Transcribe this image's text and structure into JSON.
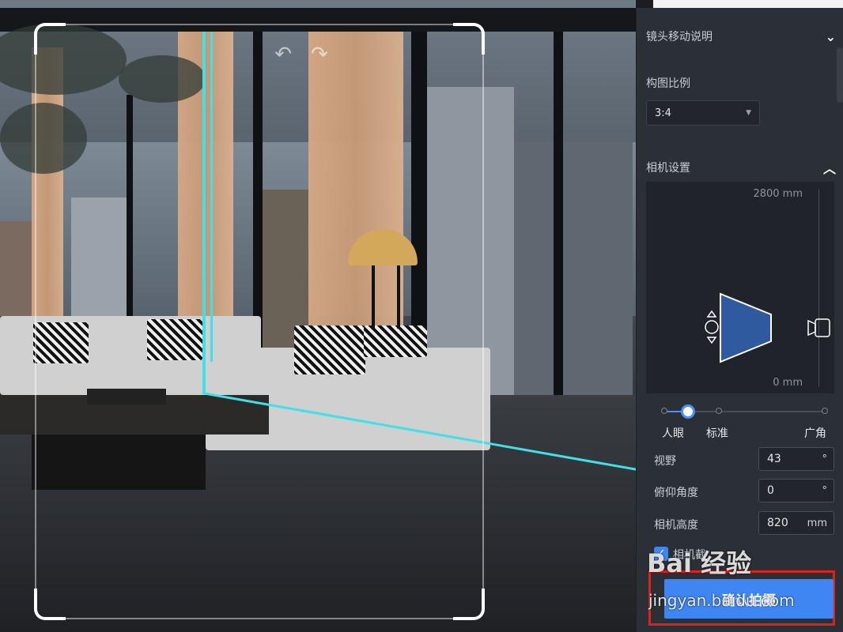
{
  "panel": {
    "lens_help_title": "镜头移动说明",
    "composition_title": "构图比例",
    "composition_value": "3:4",
    "camera_settings_title": "相机设置",
    "height_top_label": "2800 mm",
    "height_bottom_label": "0 mm",
    "lens_presets": [
      "人眼",
      "标准",
      "广角"
    ],
    "fov_label": "视野",
    "fov_value": "43",
    "fov_unit": "°",
    "tilt_label": "俯仰角度",
    "tilt_value": "0",
    "tilt_unit": "°",
    "height_label": "相机高度",
    "height_value": "820",
    "height_unit": "mm",
    "clip_label": "相机截",
    "confirm_label": "确认拍摄"
  },
  "watermark": {
    "brand": "Bai 经验",
    "site": "jingyan.baidu.com"
  },
  "colors": {
    "accent": "#3f86f2",
    "highlight_border": "#e0201a",
    "guide_line": "#3fe0e8"
  }
}
